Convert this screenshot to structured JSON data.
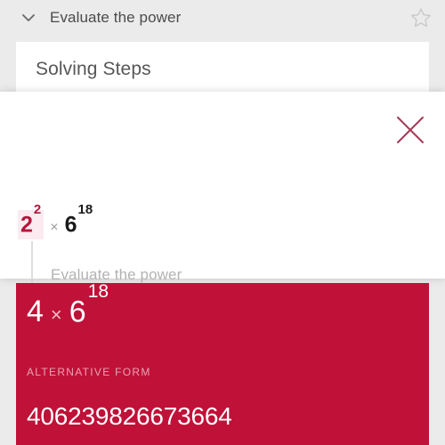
{
  "header": {
    "title": "Evaluate the power",
    "chevron_icon": "chevron-down-icon",
    "star_icon": "star-outline-icon"
  },
  "solving_card": {
    "title": "Solving Steps"
  },
  "step_popup": {
    "close_icon": "close-x-icon",
    "arrow_icon": "down-arrow-icon",
    "caption": "Evaluate the power",
    "expression_before": {
      "base1": "2",
      "exp1": "2",
      "operator": "×",
      "base2": "6",
      "exp2": "18"
    },
    "expression_after": {
      "base1": "4",
      "operator": "×",
      "base2": "6",
      "exp2": "18"
    }
  },
  "result_card": {
    "expression": {
      "base1": "4",
      "operator": "×",
      "base2": "6",
      "exp2": "18"
    },
    "alternative_form_label": "ALTERNATIVE FORM",
    "alternative_form_value": "406239826673664"
  },
  "colors": {
    "page_background": "#ebebeb",
    "card_white": "#ffffff",
    "brand_red": "#c01138",
    "highlight_red": "#b5143b",
    "highlight_bg": "#fbeaef",
    "muted_gray": "#b3b3b3"
  }
}
